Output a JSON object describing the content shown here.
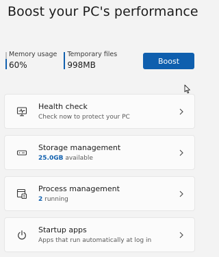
{
  "header": {
    "title": "Boost your PC's performance"
  },
  "stats": [
    {
      "label": "Memory usage",
      "value": "60%",
      "level": 0.6
    },
    {
      "label": "Temporary files",
      "value": "998MB",
      "level": 1.0
    }
  ],
  "boost_button": {
    "label": "Boost"
  },
  "colors": {
    "accent": "#0f5fae",
    "background": "#f3f3f3",
    "card": "#fbfbfb"
  },
  "cards": [
    {
      "icon": "health-monitor-icon",
      "title": "Health check",
      "subtitle": "Check now to protect your PC"
    },
    {
      "icon": "storage-drive-icon",
      "title": "Storage management",
      "subtitle_value": "25.0GB",
      "subtitle_suffix": " available"
    },
    {
      "icon": "process-window-icon",
      "title": "Process management",
      "subtitle_value": "2",
      "subtitle_suffix": " running"
    },
    {
      "icon": "power-icon",
      "title": "Startup apps",
      "subtitle": "Apps that run automatically at log in"
    }
  ]
}
